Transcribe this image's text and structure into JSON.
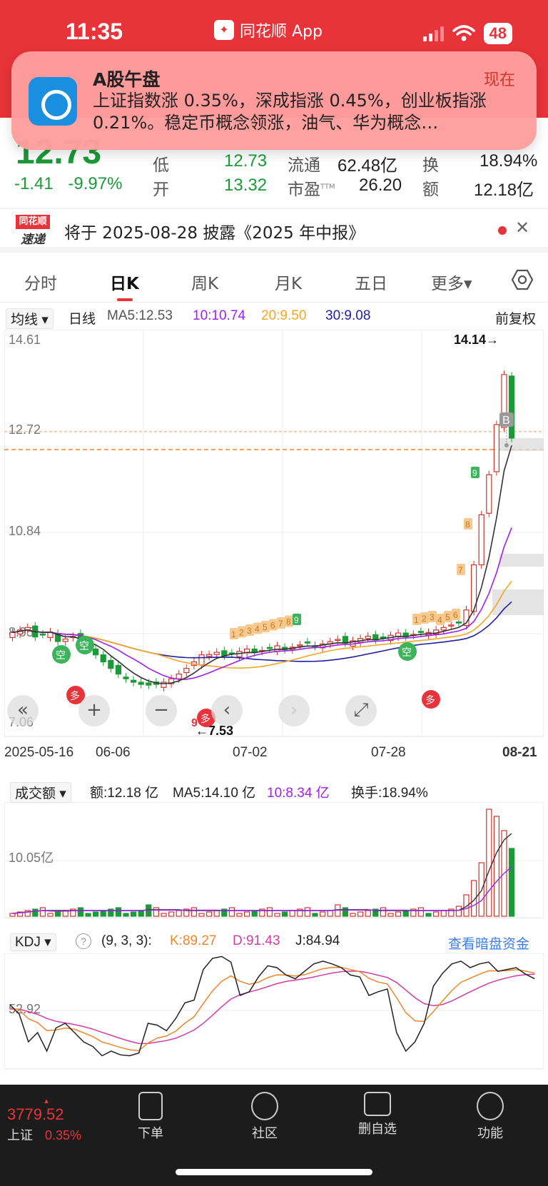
{
  "status_bar": {
    "time": "11:35",
    "app_name": "同花顺 App",
    "battery": "48"
  },
  "notification": {
    "title": "A股午盘",
    "time": "现在",
    "body": "上证指数涨 0.35%，深成指涨 0.45%，创业板指涨 0.21%。稳定币概念领涨，油气、华为概念…"
  },
  "quote": {
    "price": "12.73",
    "change": "-1.41",
    "change_pct": "-9.97%",
    "low_label": "低",
    "low": "12.73",
    "open_label": "开",
    "open": "13.32",
    "float_label": "流通",
    "float": "62.48亿",
    "pe_label": "市盈",
    "pe_sup": "TTM",
    "pe": "26.20",
    "turnover_label": "换",
    "turnover": "18.94%",
    "amount_label": "额",
    "amount": "12.18亿"
  },
  "notice": {
    "logo_top": "同花顺",
    "logo_bottom": "速递",
    "text": "将于 2025-08-28 披露《2025 年中报》"
  },
  "tabs": [
    "分时",
    "日K",
    "周K",
    "月K",
    "五日",
    "更多▾"
  ],
  "ma_bar": {
    "selector": "均线 ▾",
    "period": "日线",
    "ma5": "MA5:12.53",
    "ma10": "10:10.74",
    "ma20": "20:9.50",
    "ma30": "30:9.08",
    "adjust": "前复权"
  },
  "kline": {
    "y_labels": [
      "14.61",
      "12.72",
      "10.84",
      "8.95",
      "7.06"
    ],
    "high_marker": "14.14→",
    "low_marker": "←7.53",
    "badge_b": "B",
    "signal_short": "空",
    "signal_long": "多",
    "td_seq_1": [
      "1",
      "2",
      "3",
      "4",
      "5",
      "6",
      "7",
      "8",
      "9"
    ],
    "td_seq_2": [
      "1",
      "2",
      "3",
      "4",
      "5",
      "6",
      "7",
      "8",
      "9"
    ],
    "td_nine": "9"
  },
  "x_axis": [
    "2025-05-16",
    "06-06",
    "07-02",
    "07-28",
    "08-21"
  ],
  "volume": {
    "selector": "成交额 ▾",
    "amount": "额:12.18 亿",
    "ma5": "MA5:14.10 亿",
    "ma10": "10:8.34 亿",
    "turnover": "换手:18.94%",
    "y_label": "10.05亿"
  },
  "kdj": {
    "selector": "KDJ ▾",
    "help": "?",
    "params": "(9, 3, 3):",
    "k": "K:89.27",
    "d": "D:91.43",
    "j": "J:84.94",
    "link": "查看暗盘资金",
    "y_label": "52.92"
  },
  "bottom_nav": {
    "index_value": "3779.52",
    "index_name": "上证",
    "index_pct": "0.35%",
    "items": [
      "下单",
      "社区",
      "删自选",
      "功能"
    ]
  },
  "colors": {
    "up": "#d2352c",
    "down": "#1b9b37",
    "brand": "#e9333a",
    "ma5": "#333333",
    "ma10": "#a020f0",
    "ma20": "#f5a623",
    "ma30": "#1f1fa0"
  }
}
